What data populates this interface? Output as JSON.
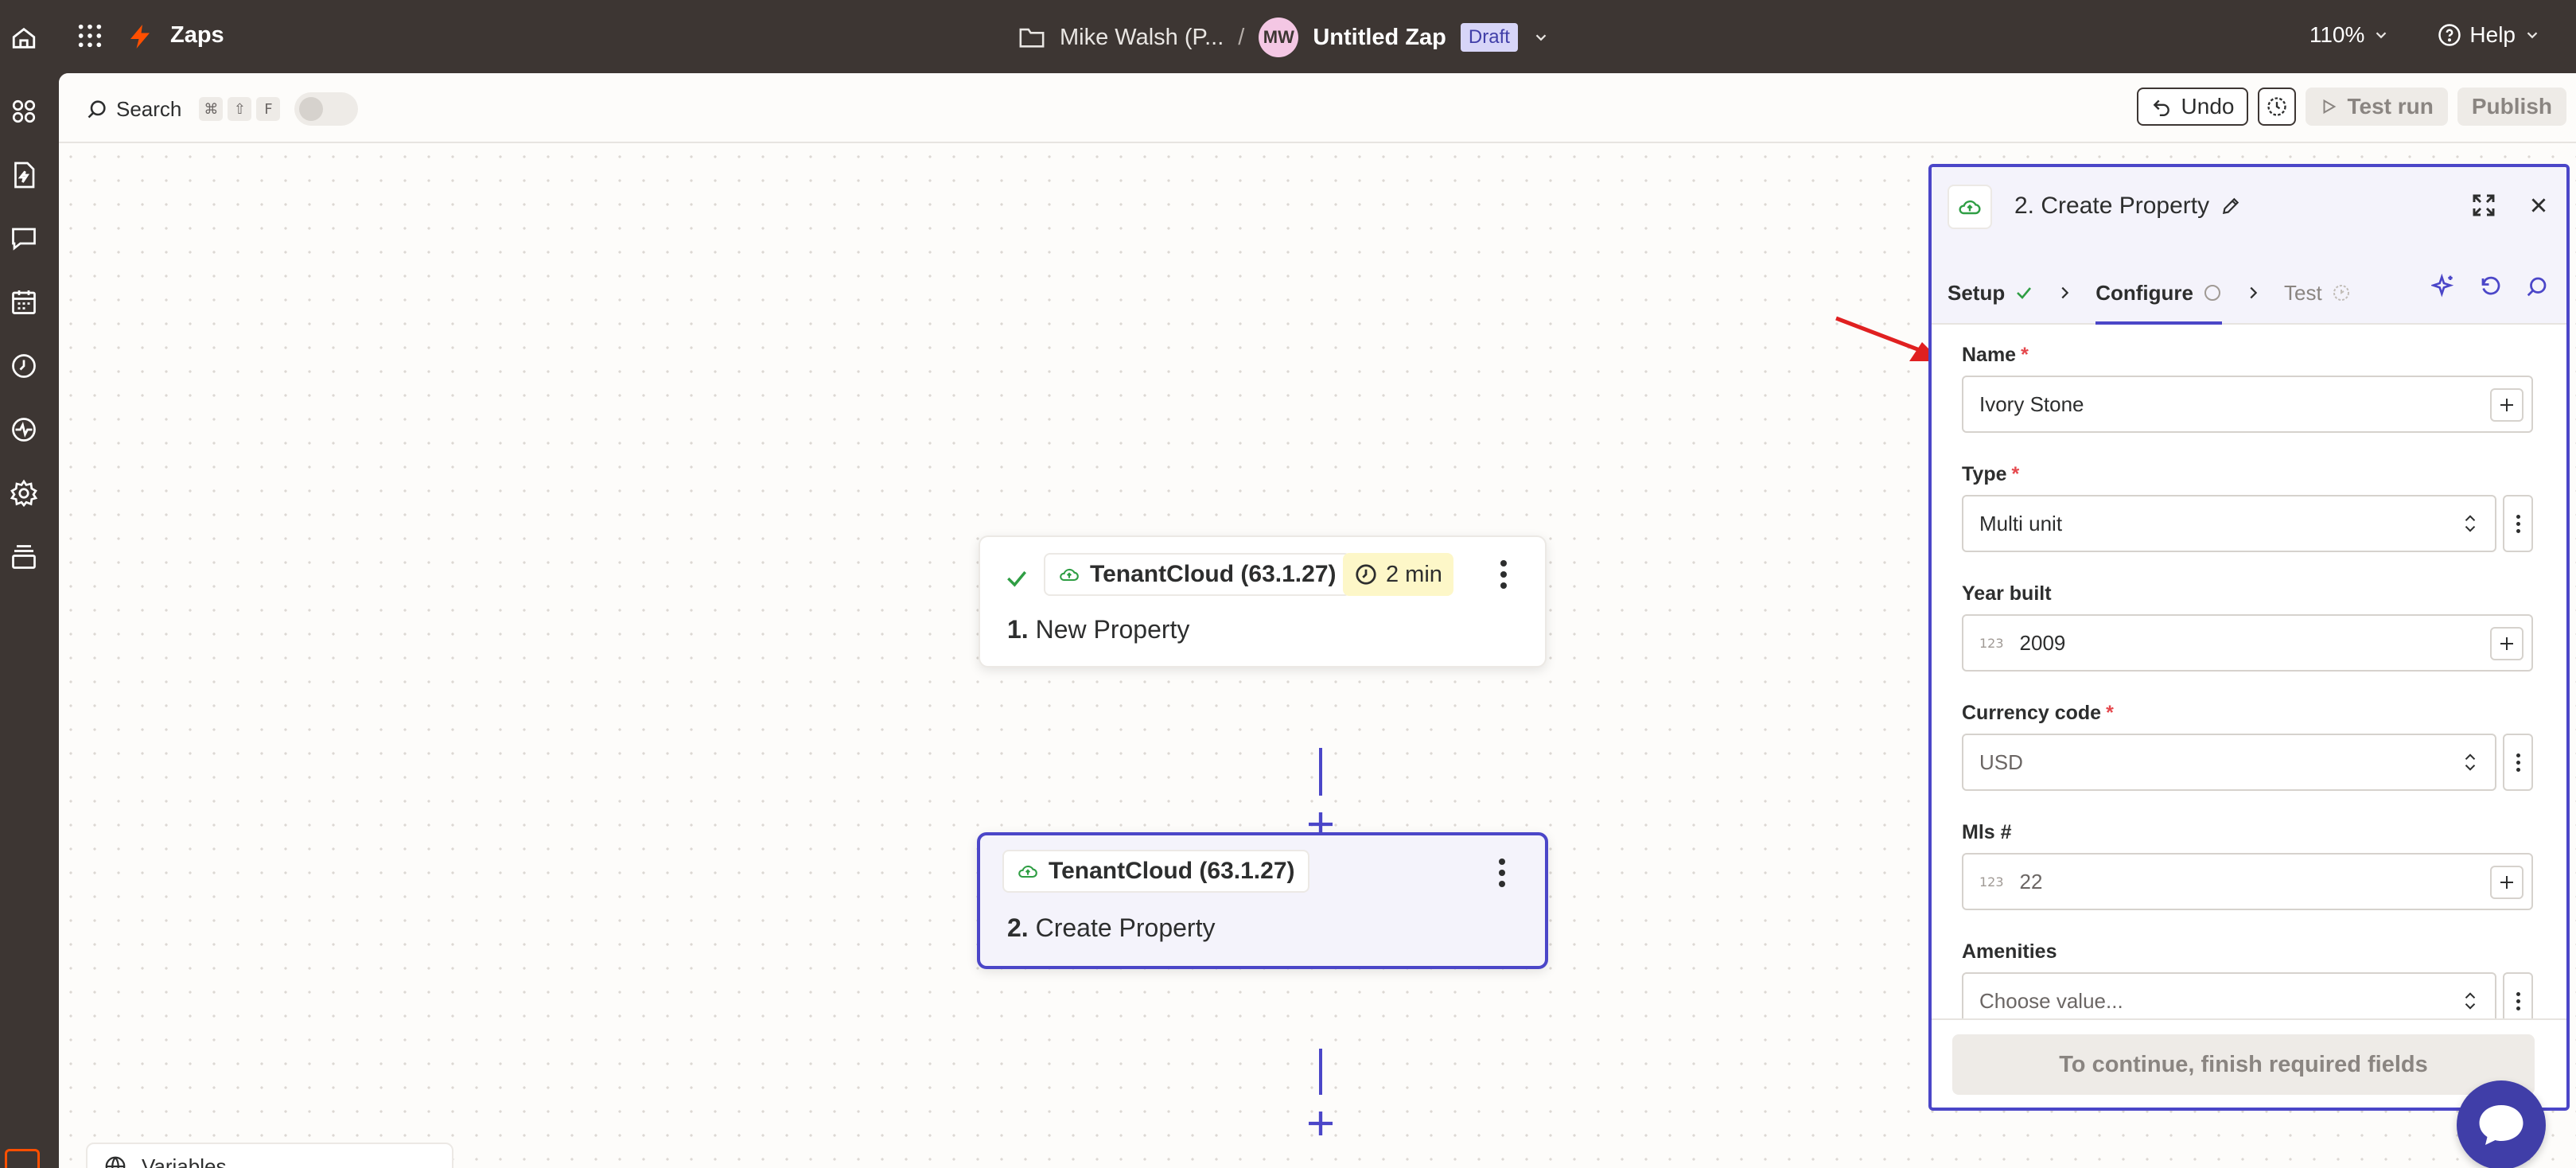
{
  "topbar": {
    "app_name": "Zaps",
    "folder_name": "Mike Walsh (P...",
    "separator": "/",
    "avatar_initials": "MW",
    "zap_title": "Untitled Zap",
    "status": "Draft",
    "zoom": "110%",
    "help": "Help"
  },
  "toolbar": {
    "search_label": "Search",
    "shortcut_keys": [
      "⌘",
      "⇧",
      "F"
    ],
    "undo_label": "Undo",
    "test_run_label": "Test run",
    "publish_label": "Publish"
  },
  "steps": [
    {
      "app": "TenantCloud (63.1.27)",
      "time": "2 min",
      "number": "1.",
      "title": "New Property"
    },
    {
      "app": "TenantCloud (63.1.27)",
      "number": "2.",
      "title": "Create Property"
    }
  ],
  "panel": {
    "title": "2. Create Property",
    "tabs": [
      {
        "label": "Setup"
      },
      {
        "label": "Configure"
      },
      {
        "label": "Test"
      }
    ],
    "fields": {
      "name": {
        "label": "Name",
        "required": "*",
        "value": "Ivory Stone"
      },
      "type": {
        "label": "Type",
        "required": "*",
        "value": "Multi unit"
      },
      "year_built": {
        "label": "Year built",
        "tag": "123",
        "value": "2009"
      },
      "currency": {
        "label": "Currency code",
        "required": "*",
        "value": "USD"
      },
      "mls": {
        "label": "Mls #",
        "tag": "123",
        "value": "22"
      },
      "amenities": {
        "label": "Amenities",
        "placeholder": "Choose value..."
      }
    },
    "continue_label": "To continue, finish required fields"
  },
  "bottom_bar": {
    "variables_label": "Variables"
  },
  "colors": {
    "brand_orange": "#ff4f00",
    "accent_purple": "#4b46c8",
    "topbar_bg": "#3d3633",
    "success_green": "#2f9e44",
    "required_red": "#e5484d"
  }
}
